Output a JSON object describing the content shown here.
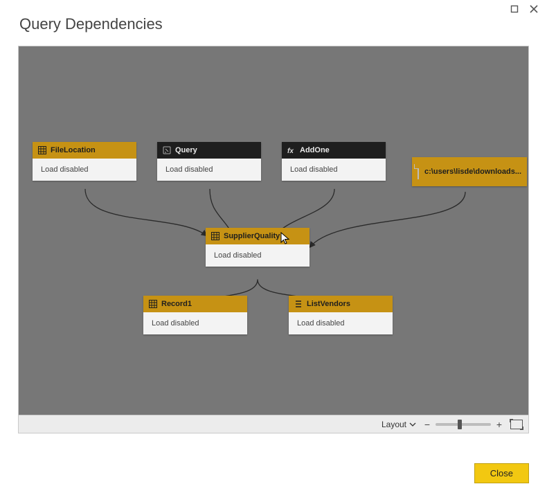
{
  "dialog": {
    "title": "Query Dependencies",
    "close_label": "Close"
  },
  "toolbar": {
    "layout_label": "Layout",
    "zoom_minus": "−",
    "zoom_plus": "+"
  },
  "nodes": {
    "file_location": {
      "title": "FileLocation",
      "status": "Load disabled",
      "kind": "table",
      "header_theme": "gold"
    },
    "query": {
      "title": "Query",
      "status": "Load disabled",
      "kind": "param",
      "header_theme": "black"
    },
    "add_one": {
      "title": "AddOne",
      "status": "Load disabled",
      "kind": "function",
      "header_theme": "black"
    },
    "source_file": {
      "title": "c:\\users\\lisde\\downloads...",
      "kind": "file"
    },
    "supplier_quality": {
      "title": "SupplierQuality",
      "status": "Load disabled",
      "kind": "table",
      "header_theme": "gold"
    },
    "record1": {
      "title": "Record1",
      "status": "Load disabled",
      "kind": "table",
      "header_theme": "gold"
    },
    "list_vendors": {
      "title": "ListVendors",
      "status": "Load disabled",
      "kind": "list",
      "header_theme": "gold"
    }
  },
  "edges": [
    {
      "from": "file_location",
      "to": "supplier_quality"
    },
    {
      "from": "query",
      "to": "supplier_quality"
    },
    {
      "from": "add_one",
      "to": "supplier_quality"
    },
    {
      "from": "source_file",
      "to": "supplier_quality"
    },
    {
      "from": "supplier_quality",
      "to": "record1"
    },
    {
      "from": "supplier_quality",
      "to": "list_vendors"
    }
  ],
  "colors": {
    "accent_gold": "#c69214",
    "accent_button": "#f2c811",
    "canvas_bg": "#777777"
  }
}
